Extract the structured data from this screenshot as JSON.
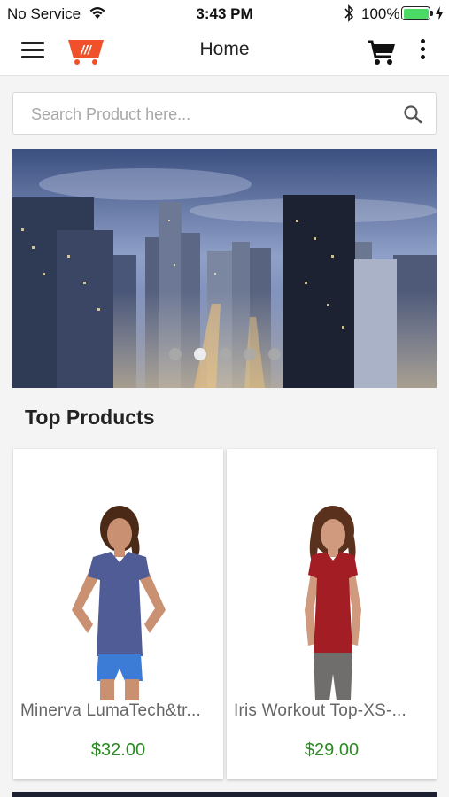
{
  "status_bar": {
    "carrier": "No Service",
    "time": "3:43 PM",
    "battery": "100%",
    "icons": [
      "wifi-icon",
      "bluetooth-icon",
      "battery-icon",
      "charging-icon"
    ]
  },
  "header": {
    "title": "Home",
    "icons": [
      "menu-icon",
      "logo-cart-icon",
      "cart-icon",
      "more-vertical-icon"
    ],
    "logo_color": "#f0502a"
  },
  "search": {
    "placeholder": "Search Product here...",
    "value": ""
  },
  "banner": {
    "slide_count": 5,
    "active_index": 1
  },
  "top_products": {
    "title": "Top Products",
    "items": [
      {
        "name": "Minerva LumaTech&trade; V-Tee-XS-Blue",
        "price": "$32.00",
        "display_name": "Minerva LumaTech&tr..."
      },
      {
        "name": "Iris Workout Top-XS-Red",
        "price": "$29.00",
        "display_name": "Iris Workout Top-XS-..."
      }
    ]
  },
  "colors": {
    "price": "#2a8a22",
    "battery": "#4cd964"
  }
}
